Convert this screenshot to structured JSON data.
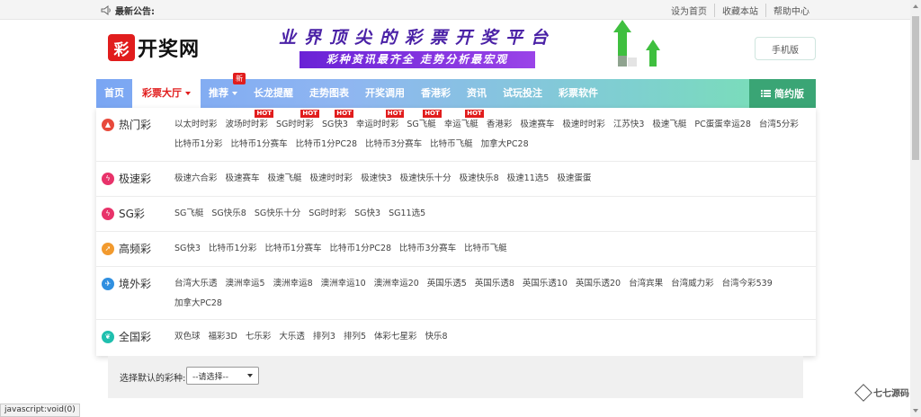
{
  "topbar": {
    "notice": "最新公告:",
    "links": [
      "设为首页",
      "收藏本站",
      "帮助中心"
    ]
  },
  "header": {
    "logo_text": "开奖网",
    "logo_mark": "彩",
    "slogan_line1": "业界顶尖的彩票开奖平台",
    "slogan_line2": "彩种资讯最齐全  走势分析最宏观",
    "mobile_button": "手机版"
  },
  "nav": {
    "items": [
      {
        "label": "首页"
      },
      {
        "label": "彩票大厅",
        "active": true,
        "caret": true
      },
      {
        "label": "推荐",
        "caret": true,
        "badge": "新"
      },
      {
        "label": "长龙提醒"
      },
      {
        "label": "走势图表"
      },
      {
        "label": "开奖调用"
      },
      {
        "label": "香港彩"
      },
      {
        "label": "资讯"
      },
      {
        "label": "试玩投注"
      },
      {
        "label": "彩票软件"
      }
    ],
    "simple_label": "简约版"
  },
  "categories": [
    {
      "name": "热门彩",
      "icon": "flame-icon",
      "color": "#e84a3c",
      "games": [
        {
          "n": "以太时时彩"
        },
        {
          "n": "波场时时彩",
          "hot": true
        },
        {
          "n": "SG时时彩",
          "hot": true
        },
        {
          "n": "SG快3",
          "hot": true
        },
        {
          "n": "幸运时时彩",
          "hot": true
        },
        {
          "n": "SG飞艇",
          "hot": true
        },
        {
          "n": "幸运飞艇",
          "hot": true
        },
        {
          "n": "香港彩"
        },
        {
          "n": "极速赛车"
        },
        {
          "n": "极速时时彩"
        },
        {
          "n": "江苏快3"
        },
        {
          "n": "极速飞艇"
        },
        {
          "n": "PC蛋蛋幸运28"
        },
        {
          "n": "台湾5分彩"
        },
        {
          "n": "比特币1分彩"
        },
        {
          "n": "比特币1分赛车"
        },
        {
          "n": "比特币1分PC28"
        },
        {
          "n": "比特币3分赛车"
        },
        {
          "n": "比特币飞艇"
        },
        {
          "n": "加拿大PC28"
        }
      ]
    },
    {
      "name": "极速彩",
      "icon": "lightning-icon",
      "color": "#e8336a",
      "games": [
        {
          "n": "极速六合彩"
        },
        {
          "n": "极速赛车"
        },
        {
          "n": "极速飞艇"
        },
        {
          "n": "极速时时彩"
        },
        {
          "n": "极速快3"
        },
        {
          "n": "极速快乐十分"
        },
        {
          "n": "极速快乐8"
        },
        {
          "n": "极速11选5"
        },
        {
          "n": "极速蛋蛋"
        }
      ]
    },
    {
      "name": "SG彩",
      "icon": "lightning-icon",
      "color": "#e8336a",
      "games": [
        {
          "n": "SG飞艇"
        },
        {
          "n": "SG快乐8"
        },
        {
          "n": "SG快乐十分"
        },
        {
          "n": "SG时时彩"
        },
        {
          "n": "SG快3"
        },
        {
          "n": "SG11选5"
        }
      ]
    },
    {
      "name": "高频彩",
      "icon": "rocket-icon",
      "color": "#f29a2e",
      "games": [
        {
          "n": "SG快3"
        },
        {
          "n": "比特币1分彩"
        },
        {
          "n": "比特币1分赛车"
        },
        {
          "n": "比特币1分PC28"
        },
        {
          "n": "比特币3分赛车"
        },
        {
          "n": "比特币飞艇"
        }
      ]
    },
    {
      "name": "境外彩",
      "icon": "plane-icon",
      "color": "#2f8fe0",
      "games": [
        {
          "n": "台湾大乐透"
        },
        {
          "n": "澳洲幸运5"
        },
        {
          "n": "澳洲幸运8"
        },
        {
          "n": "澳洲幸运10"
        },
        {
          "n": "澳洲幸运20"
        },
        {
          "n": "英国乐透5"
        },
        {
          "n": "英国乐透8"
        },
        {
          "n": "英国乐透10"
        },
        {
          "n": "英国乐透20"
        },
        {
          "n": "台湾宾果"
        },
        {
          "n": "台湾威力彩"
        },
        {
          "n": "台湾今彩539"
        },
        {
          "n": "加拿大PC28"
        }
      ]
    },
    {
      "name": "全国彩",
      "icon": "leaf-icon",
      "color": "#1fbfae",
      "games": [
        {
          "n": "双色球"
        },
        {
          "n": "福彩3D"
        },
        {
          "n": "七乐彩"
        },
        {
          "n": "大乐透"
        },
        {
          "n": "排列3"
        },
        {
          "n": "排列5"
        },
        {
          "n": "体彩七星彩"
        },
        {
          "n": "快乐8"
        }
      ]
    }
  ],
  "hot_label": "HOT",
  "panel": {
    "label": "选择默认的彩种:",
    "select_value": "--请选择--"
  },
  "status_bar": "javascript:void(0)",
  "brand": "七七源码"
}
